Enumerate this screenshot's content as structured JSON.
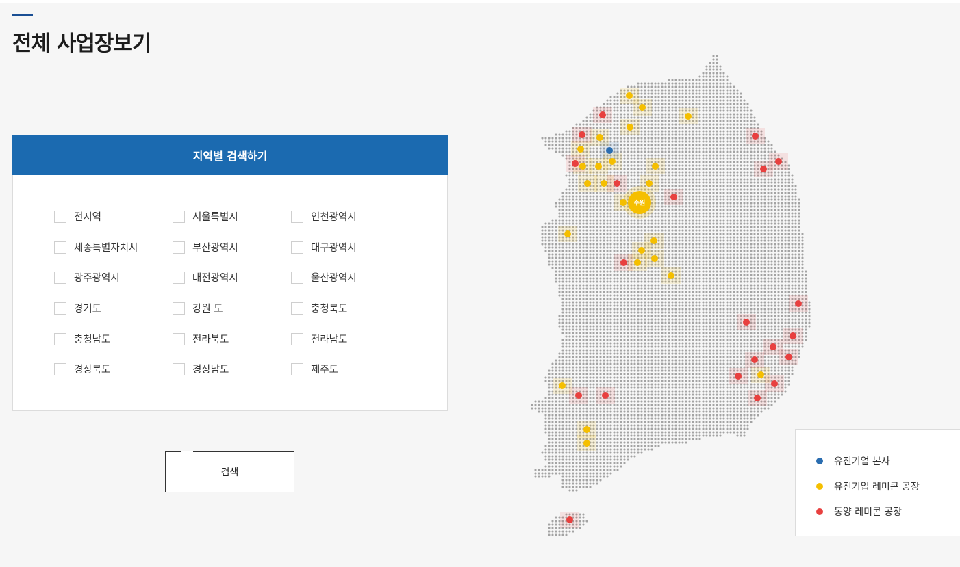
{
  "page_title": "전체 사업장보기",
  "search_panel": {
    "header": "지역별 검색하기",
    "regions": [
      "전지역",
      "서울특별시",
      "인천광역시",
      "세종특별자치시",
      "부산광역시",
      "대구광역시",
      "광주광역시",
      "대전광역시",
      "울산광역시",
      "경기도",
      "강원 도",
      "충청북도",
      "충청남도",
      "전라북도",
      "전라남도",
      "경상북도",
      "경상남도",
      "제주도"
    ]
  },
  "search_button": "검색",
  "map": {
    "highlight_label": "수원",
    "legend": [
      {
        "label": "유진기업 본사",
        "color": "#2a6db0"
      },
      {
        "label": "유진기업 레미콘 공장",
        "color": "#f5bf00"
      },
      {
        "label": "동양 레미콘 공장",
        "color": "#e8403f"
      }
    ]
  }
}
